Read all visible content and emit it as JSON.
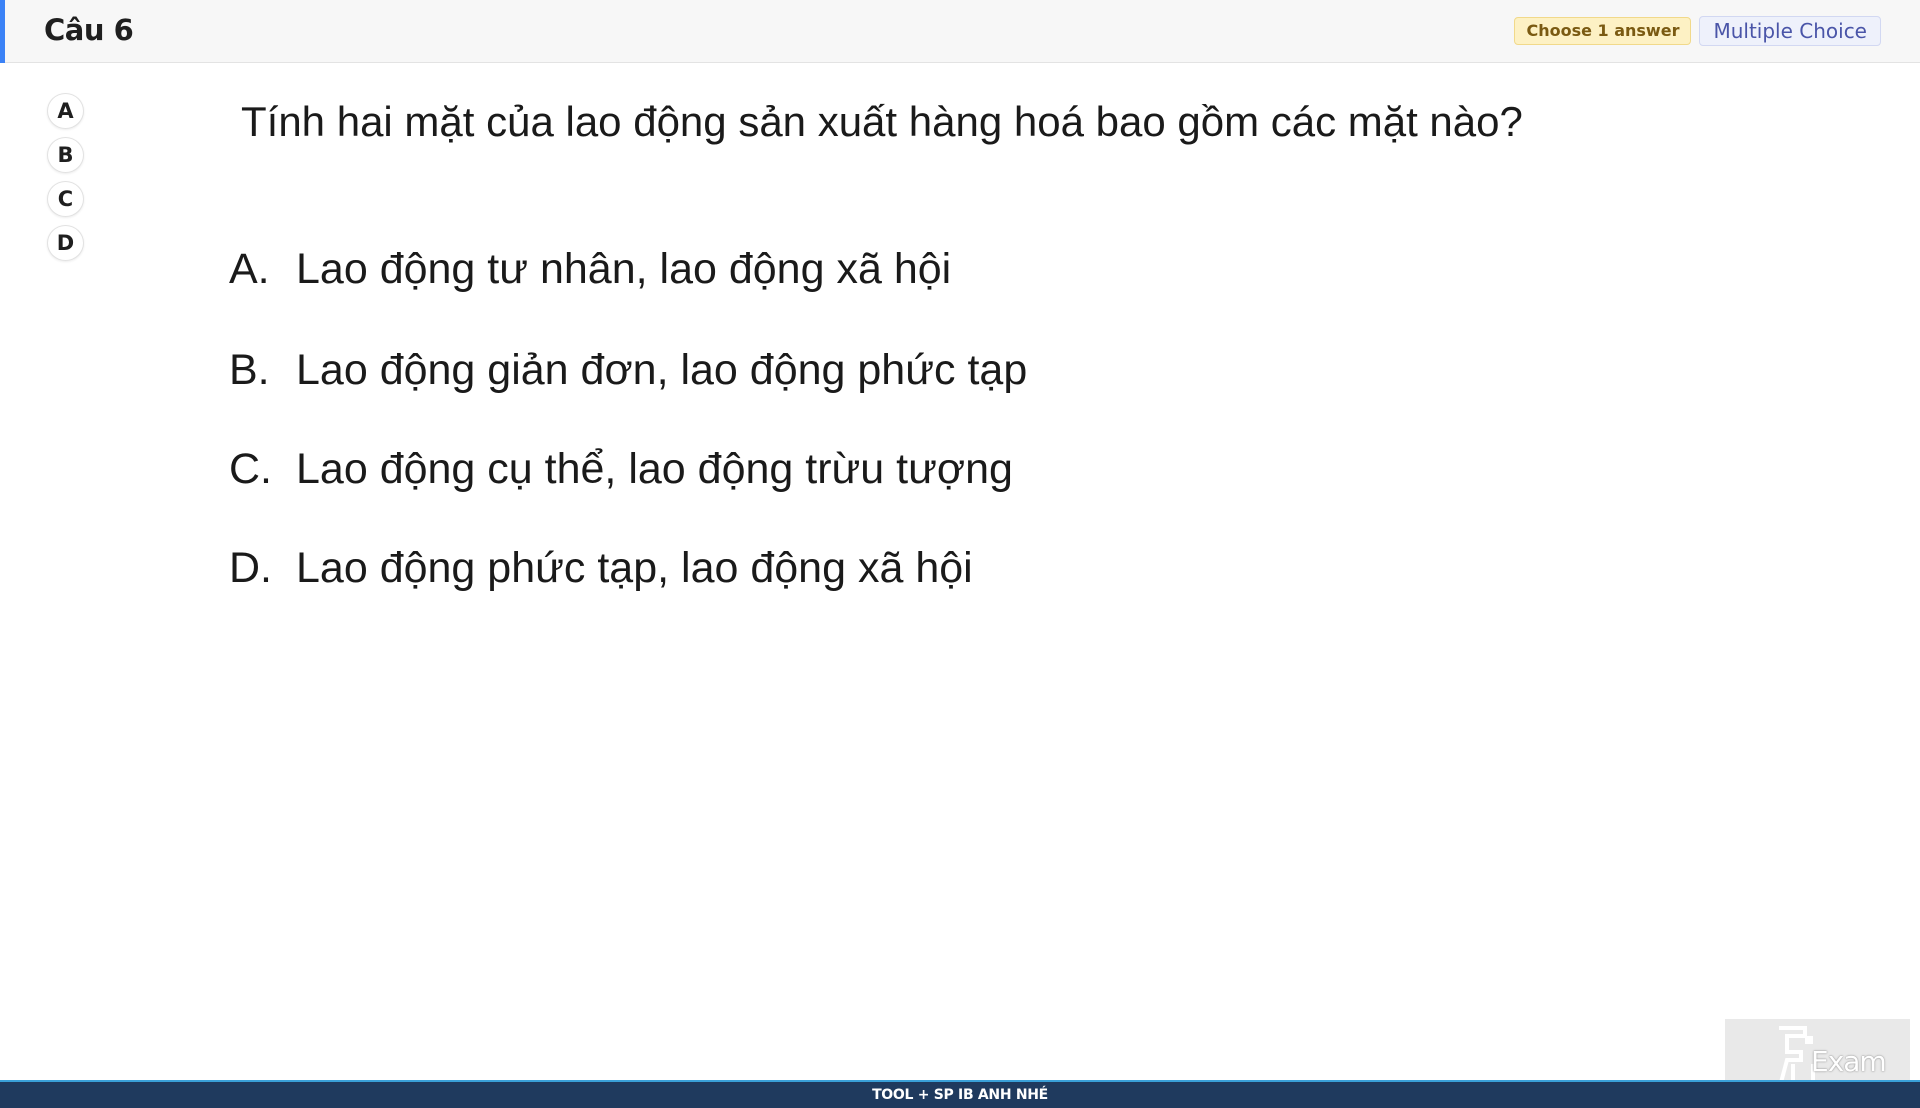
{
  "header": {
    "question_label": "Câu 6",
    "choose_badge": "Choose 1 answer",
    "type_badge": "Multiple Choice"
  },
  "options": [
    {
      "letter": "A"
    },
    {
      "letter": "B"
    },
    {
      "letter": "C"
    },
    {
      "letter": "D"
    }
  ],
  "question": {
    "text": "Tính hai mặt của lao động sản xuất hàng hoá bao gồm các mặt nào?",
    "answers": [
      {
        "letter": "A.",
        "text": "Lao động tư nhân, lao động xã hội"
      },
      {
        "letter": "B.",
        "text": "Lao động giản đơn, lao động phức tạp"
      },
      {
        "letter": "C.",
        "text": "Lao động cụ thể, lao động trừu tượng"
      },
      {
        "letter": "D.",
        "text": "Lao động phức tạp, lao động xã hội"
      }
    ]
  },
  "watermark": {
    "text": "Exam"
  },
  "footer": {
    "text": "TOOL + SP IB ANH NHÉ"
  },
  "colors": {
    "accent": "#3b82f6",
    "footer_bg": "#1f3a5e",
    "badge_yellow": "#fdf1c4",
    "badge_blue": "#eef1fb"
  }
}
